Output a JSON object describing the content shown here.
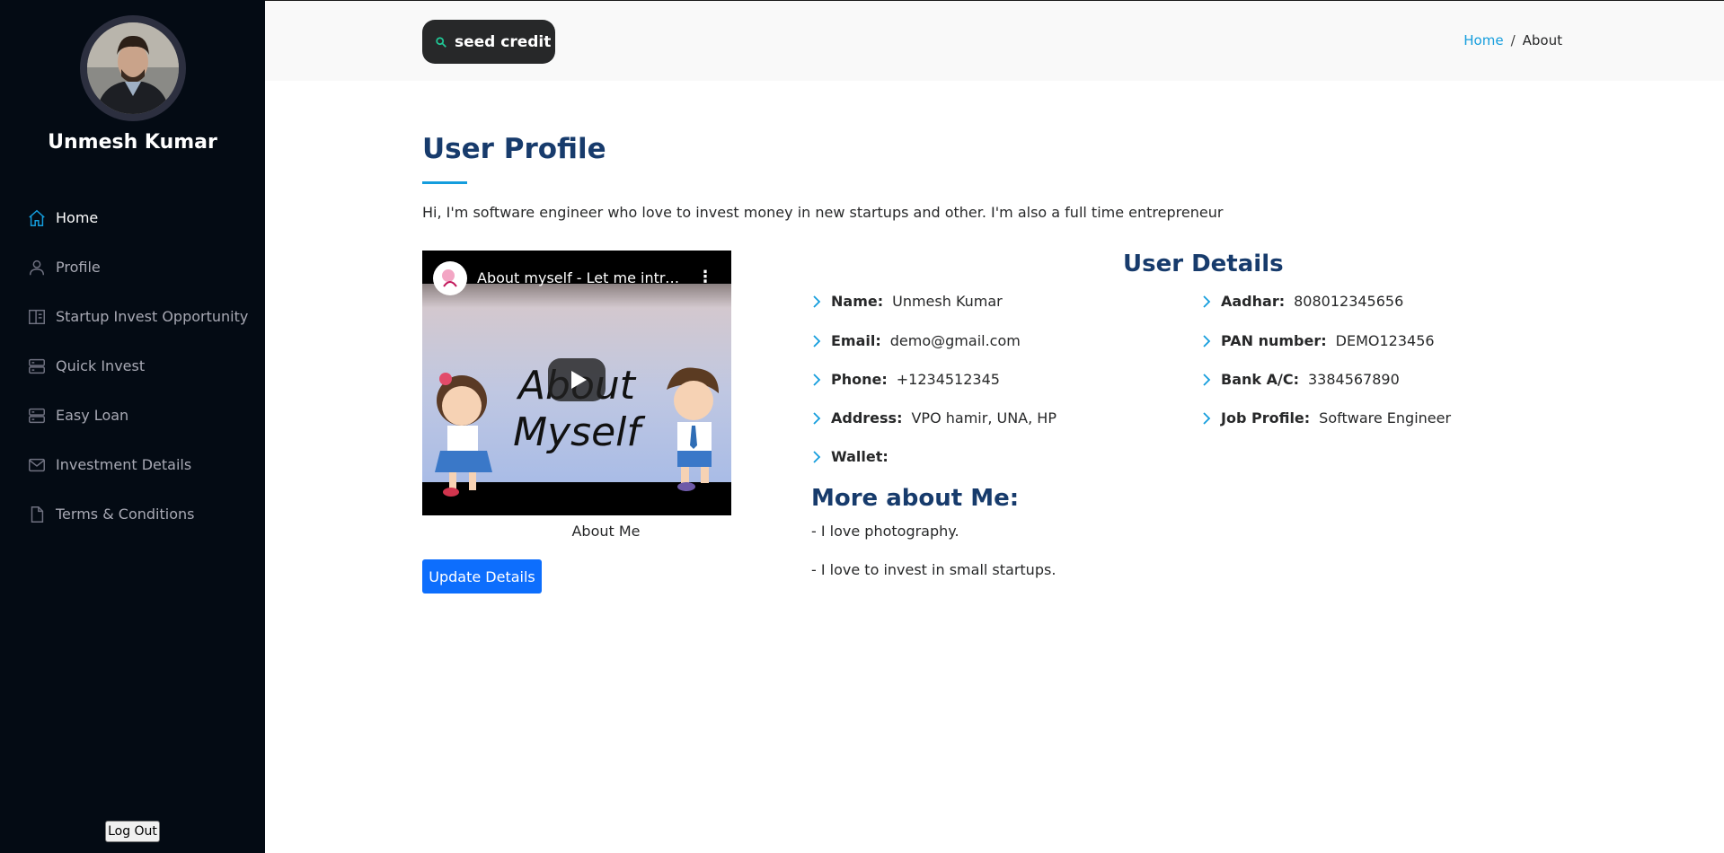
{
  "sidebar": {
    "profile_name": "Unmesh Kumar",
    "items": [
      {
        "label": "Home",
        "icon": "home-icon",
        "active": true
      },
      {
        "label": "Profile",
        "icon": "person-icon",
        "active": false
      },
      {
        "label": "Startup Invest Opportunity",
        "icon": "layout-icon",
        "active": false
      },
      {
        "label": "Quick Invest",
        "icon": "server-icon",
        "active": false
      },
      {
        "label": "Easy Loan",
        "icon": "server-icon",
        "active": false
      },
      {
        "label": "Investment Details",
        "icon": "envelope-icon",
        "active": false
      },
      {
        "label": "Terms & Conditions",
        "icon": "file-icon",
        "active": false
      }
    ],
    "logout_label": "Log Out"
  },
  "header": {
    "logo_text": "seed credit",
    "breadcrumb": {
      "home": "Home",
      "separator": "/",
      "current": "About"
    }
  },
  "main": {
    "title": "User Profile",
    "intro": "Hi, I'm software engineer who love to invest money in new startups and other. I'm also a full time entrepreneur",
    "video": {
      "title": "About myself - Let me intro...",
      "thumbnail_text_line1": "About",
      "thumbnail_text_line2": "Myself",
      "caption": "About Me"
    },
    "update_button": "Update Details",
    "details_title": "User Details",
    "details_left": [
      {
        "label": "Name:",
        "value": "Unmesh Kumar"
      },
      {
        "label": "Email:",
        "value": "demo@gmail.com"
      },
      {
        "label": "Phone:",
        "value": "+1234512345"
      },
      {
        "label": "Address:",
        "value": "VPO hamir, UNA, HP"
      },
      {
        "label": "Wallet:",
        "value": ""
      }
    ],
    "details_right": [
      {
        "label": "Aadhar:",
        "value": "808012345656"
      },
      {
        "label": "PAN number:",
        "value": "DEMO123456"
      },
      {
        "label": "Bank A/C:",
        "value": "3384567890"
      },
      {
        "label": "Job Profile:",
        "value": "Software Engineer"
      }
    ],
    "more_title": "More about Me:",
    "more_items": [
      "- I love photography.",
      "- I love to invest in small startups."
    ]
  },
  "colors": {
    "sidebar_bg": "#040b14",
    "accent": "#149ddd",
    "heading": "#173b6c",
    "button": "#0d6efd"
  }
}
